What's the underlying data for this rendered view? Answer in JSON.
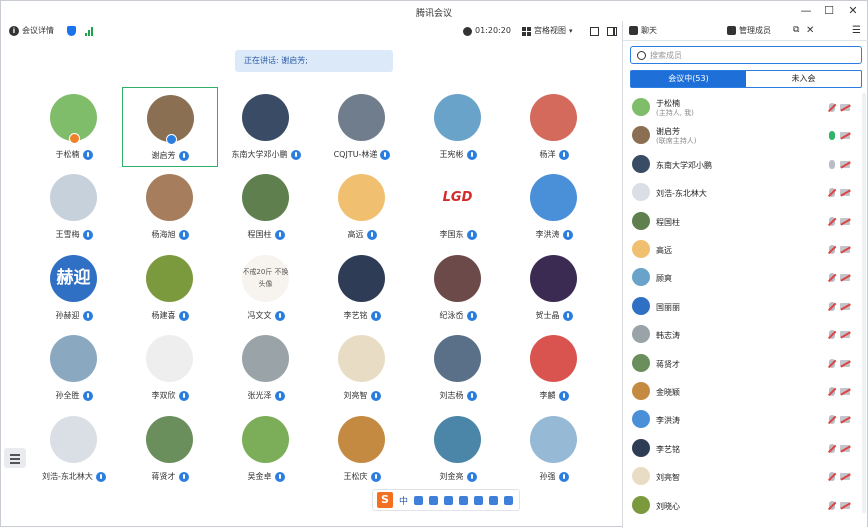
{
  "window": {
    "title": "腾讯会议"
  },
  "toolbar": {
    "meeting_info_label": "会议详情",
    "timer": "01:20:20",
    "view_label": "宫格视图"
  },
  "speaking_banner": "正在讲话: 谢启芳;",
  "grid": {
    "tiles": [
      {
        "name": "于松楠",
        "mic": true,
        "avatar": "#7fbd6a",
        "role": "host"
      },
      {
        "name": "谢启芳",
        "mic": true,
        "avatar": "#8b6f52",
        "role": "cohost",
        "active": true
      },
      {
        "name": "东南大学邓小鹏",
        "mic": true,
        "avatar": "#3a4b66"
      },
      {
        "name": "CQJTU-林递",
        "mic": true,
        "avatar": "#6f7d8c"
      },
      {
        "name": "王宪彬",
        "mic": true,
        "avatar": "#6aa3c9"
      },
      {
        "name": "杨洋",
        "mic": true,
        "avatar": "#d46a5c"
      },
      {
        "name": "王雪梅",
        "mic": true,
        "avatar": "#c7d1dc"
      },
      {
        "name": "杨海旭",
        "mic": true,
        "avatar": "#a77e5d"
      },
      {
        "name": "程国柱",
        "mic": true,
        "avatar": "#5f7f4f"
      },
      {
        "name": "高远",
        "mic": true,
        "avatar": "#f0c070"
      },
      {
        "name": "李国东",
        "mic": true,
        "avatar": "#ffffff",
        "avatar_text": "LGD",
        "avatar_text_color": "#d22b2b"
      },
      {
        "name": "李洪涛",
        "mic": true,
        "avatar": "#4a90d9"
      },
      {
        "name": "孙赫迎",
        "mic": true,
        "avatar": "#2f6fc4",
        "avatar_text": "赫迎"
      },
      {
        "name": "杨建喜",
        "mic": true,
        "avatar": "#7b9a3e"
      },
      {
        "name": "冯文文",
        "mic": true,
        "avatar": "#f7f3ee",
        "avatar_text": "不戒20斤 不换头像",
        "avatar_text_color": "#555555"
      },
      {
        "name": "李艺铭",
        "mic": true,
        "avatar": "#2e3c55"
      },
      {
        "name": "纪泳岙",
        "mic": true,
        "avatar": "#6d4a4a"
      },
      {
        "name": "贺士晶",
        "mic": true,
        "avatar": "#3b2b52"
      },
      {
        "name": "孙全胜",
        "mic": true,
        "avatar": "#8aa8c0"
      },
      {
        "name": "李双欣",
        "mic": true,
        "avatar": "#eeeeee"
      },
      {
        "name": "张光泽",
        "mic": true,
        "avatar": "#9aa3a8"
      },
      {
        "name": "刘亮智",
        "mic": true,
        "avatar": "#e8dcc5"
      },
      {
        "name": "刘志杨",
        "mic": true,
        "avatar": "#5a6f88"
      },
      {
        "name": "李麟",
        "mic": true,
        "avatar": "#d9534f"
      },
      {
        "name": "刘浩-东北林大",
        "mic": true,
        "avatar": "#d9dfe4"
      },
      {
        "name": "蒋贤才",
        "mic": true,
        "avatar": "#6b8f5c"
      },
      {
        "name": "吴金卓",
        "mic": true,
        "avatar": "#7cae5a"
      },
      {
        "name": "王松庆",
        "mic": true,
        "avatar": "#c58a42"
      },
      {
        "name": "刘金亮",
        "mic": true,
        "avatar": "#4b86a8"
      },
      {
        "name": "孙强",
        "mic": true,
        "avatar": "#96b9d6"
      }
    ]
  },
  "panel": {
    "tab_chat": "聊天",
    "tab_members": "管理成员",
    "search_placeholder": "搜索成员",
    "seg_in_meeting": "会议中(53)",
    "seg_not_joined": "未入会",
    "members": [
      {
        "name": "于松楠",
        "role": "(主持人, 我)",
        "avatar": "#7fbd6a",
        "mic": "muted",
        "cam": "off"
      },
      {
        "name": "谢启芳",
        "role": "(联席主持人)",
        "avatar": "#8b6f52",
        "mic": "on",
        "cam": "off"
      },
      {
        "name": "东南大学邓小鹏",
        "avatar": "#3a4b66",
        "mic": "idle",
        "cam": "off"
      },
      {
        "name": "刘浩-东北林大",
        "avatar": "#d9dfe4",
        "mic": "muted",
        "cam": "off"
      },
      {
        "name": "程国柱",
        "avatar": "#5f7f4f",
        "mic": "muted",
        "cam": "off"
      },
      {
        "name": "高远",
        "avatar": "#f0c070",
        "mic": "muted",
        "cam": "off"
      },
      {
        "name": "顾爽",
        "avatar": "#6aa3c9",
        "mic": "muted",
        "cam": "off"
      },
      {
        "name": "国丽丽",
        "avatar": "#2f6fc4",
        "mic": "muted",
        "cam": "off"
      },
      {
        "name": "韩志涛",
        "avatar": "#9aa3a8",
        "mic": "muted",
        "cam": "off"
      },
      {
        "name": "蒋贤才",
        "avatar": "#6b8f5c",
        "mic": "muted",
        "cam": "off"
      },
      {
        "name": "金晓颖",
        "avatar": "#c58a42",
        "mic": "muted",
        "cam": "off"
      },
      {
        "name": "李洪涛",
        "avatar": "#4a90d9",
        "mic": "muted",
        "cam": "off"
      },
      {
        "name": "李艺铭",
        "avatar": "#2e3c55",
        "mic": "muted",
        "cam": "off"
      },
      {
        "name": "刘亮智",
        "avatar": "#e8dcc5",
        "mic": "muted",
        "cam": "off"
      },
      {
        "name": "刘晓心",
        "avatar": "#7b9a3e",
        "mic": "muted",
        "cam": "off"
      }
    ]
  },
  "ime": {
    "lang": "中"
  }
}
